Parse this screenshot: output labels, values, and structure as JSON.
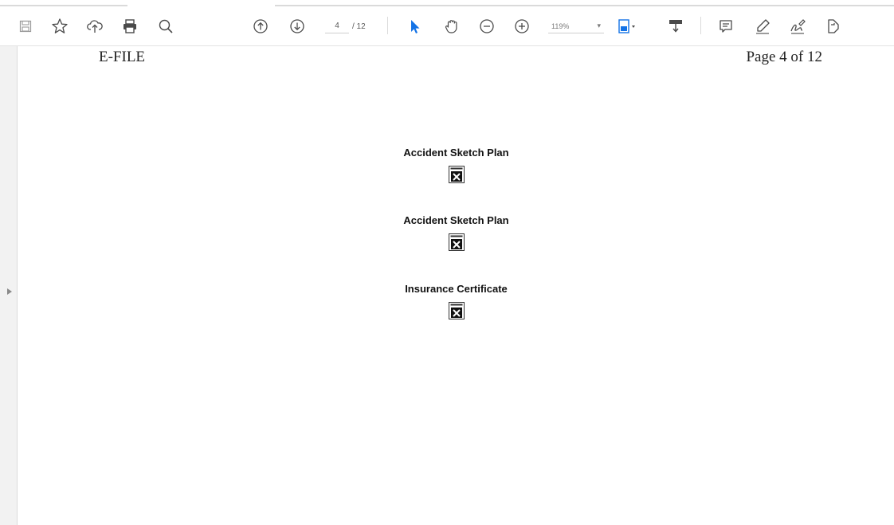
{
  "toolbar": {
    "buttons": [
      {
        "name": "save-icon"
      },
      {
        "name": "bookmark-star-icon"
      },
      {
        "name": "upload-cloud-icon"
      },
      {
        "name": "print-icon"
      },
      {
        "name": "search-icon"
      },
      {
        "name": "previous-page-icon"
      },
      {
        "name": "next-page-icon"
      },
      {
        "name": "select-pointer-icon"
      },
      {
        "name": "hand-pan-icon"
      },
      {
        "name": "zoom-out-icon"
      },
      {
        "name": "zoom-in-icon"
      },
      {
        "name": "fit-page-icon"
      },
      {
        "name": "scroll-mode-icon"
      },
      {
        "name": "comment-icon"
      },
      {
        "name": "highlight-pen-icon"
      },
      {
        "name": "sign-icon"
      },
      {
        "name": "fill-sign-icon"
      }
    ],
    "page_number": "4",
    "page_total": "/ 12",
    "zoom_level": "119%",
    "accent_color": "#1473e6"
  },
  "document": {
    "header_left": "E-FILE",
    "header_right": "Page 4 of 12",
    "sections": [
      {
        "title": "Accident Sketch Plan"
      },
      {
        "title": "Accident Sketch Plan"
      },
      {
        "title": "Insurance Certificate"
      }
    ]
  }
}
